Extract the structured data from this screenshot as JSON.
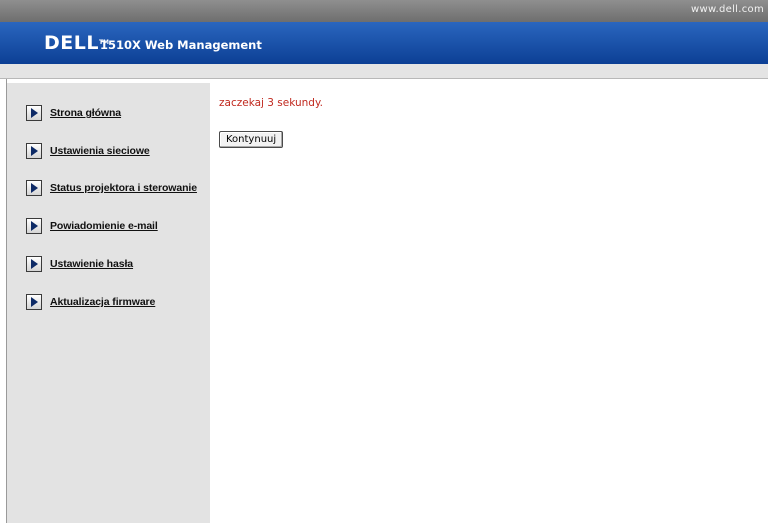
{
  "top_strip": {
    "site_link": "www.dell.com"
  },
  "header": {
    "logo_text": "DELL",
    "logo_tm": "TM",
    "product_title": "1510X Web Management"
  },
  "sidebar": {
    "items": [
      {
        "label": "Strona główna",
        "icon": "arrow-right-icon"
      },
      {
        "label": "Ustawienia sieciowe",
        "icon": "arrow-right-icon"
      },
      {
        "label": "Status projektora i sterowanie",
        "icon": "arrow-right-icon"
      },
      {
        "label": "Powiadomienie e-mail",
        "icon": "arrow-right-icon"
      },
      {
        "label": "Ustawienie hasła",
        "icon": "arrow-right-icon"
      },
      {
        "label": "Aktualizacja firmware",
        "icon": "arrow-right-icon"
      }
    ]
  },
  "main": {
    "status_message": "zaczekaj 3 sekundy.",
    "continue_label": "Kontynuuj"
  },
  "colors": {
    "header_blue": "#1450a8",
    "sidebar_gray": "#e3e3e3",
    "status_red": "#c0281e"
  }
}
